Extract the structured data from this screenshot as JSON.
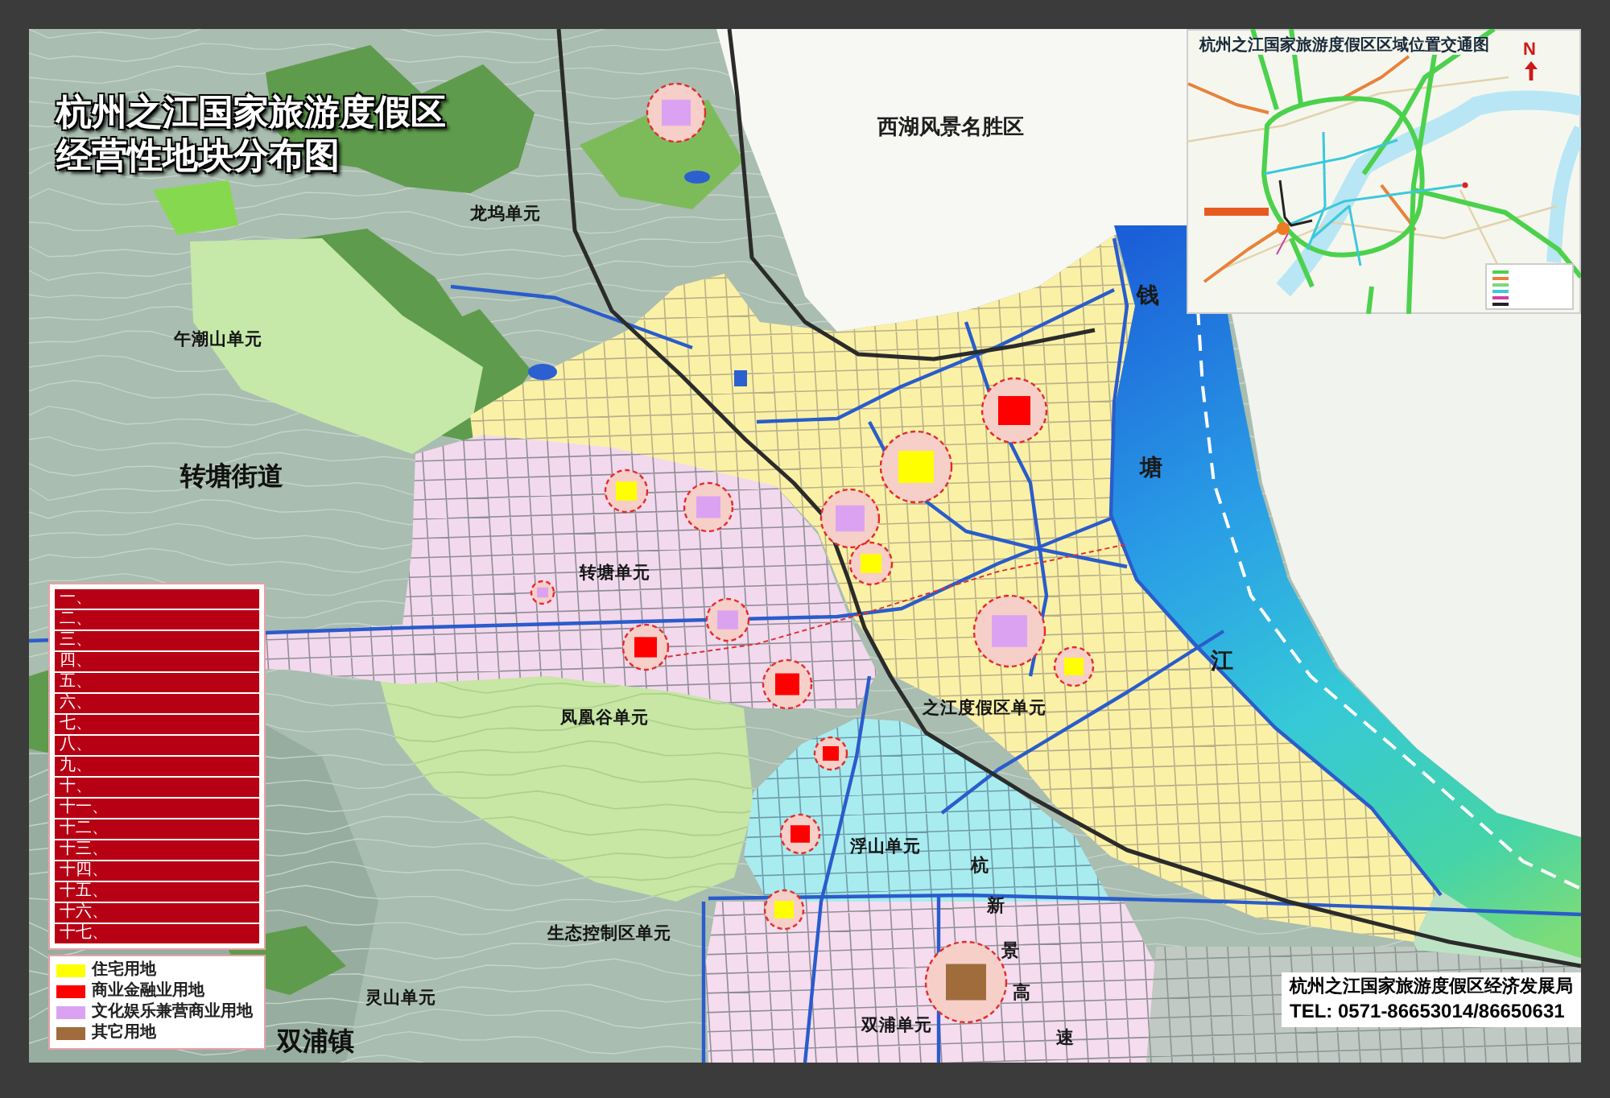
{
  "title": {
    "lines": [
      "杭州之江国家旅游度假区",
      "经营性地块分布图"
    ]
  },
  "inset_map": {
    "title": "杭州之江国家旅游度假区区域位置交通图",
    "north_label": "N"
  },
  "map_labels": [
    {
      "text": "西湖风景名胜区",
      "kind": "area"
    },
    {
      "text": "龙坞单元",
      "kind": "unit"
    },
    {
      "text": "午潮山单元",
      "kind": "unit"
    },
    {
      "text": "转塘街道",
      "kind": "district"
    },
    {
      "text": "转塘单元",
      "kind": "unit"
    },
    {
      "text": "凤凰谷单元",
      "kind": "unit"
    },
    {
      "text": "之江度假区单元",
      "kind": "unit"
    },
    {
      "text": "浮山单元",
      "kind": "unit"
    },
    {
      "text": "生态控制区单元",
      "kind": "unit"
    },
    {
      "text": "灵山单元",
      "kind": "unit"
    },
    {
      "text": "双浦单元",
      "kind": "unit"
    },
    {
      "text": "双浦镇",
      "kind": "district"
    }
  ],
  "river_label": [
    "钱",
    "塘",
    "江"
  ],
  "road_label": [
    "杭",
    "新",
    "景",
    "高",
    "速"
  ],
  "legend": {
    "plots": [
      "一、",
      "二、",
      "三、",
      "四、",
      "五、",
      "六、",
      "七、",
      "八、",
      "九、",
      "十、",
      "十一、",
      "十二、",
      "十三、",
      "十四、",
      "十五、",
      "十六、",
      "十七、"
    ],
    "land_use": [
      {
        "label": "住宅用地",
        "color": "#ffff00"
      },
      {
        "label": "商业金融业用地",
        "color": "#ff0000"
      },
      {
        "label": "文化娱乐兼营商业用地",
        "color": "#dca2f2"
      },
      {
        "label": "其它用地",
        "color": "#a06c3c"
      }
    ]
  },
  "footer": {
    "agency": "杭州之江国家旅游度假区经济发展局",
    "phone": "TEL: 0571-86653014/86650631"
  }
}
